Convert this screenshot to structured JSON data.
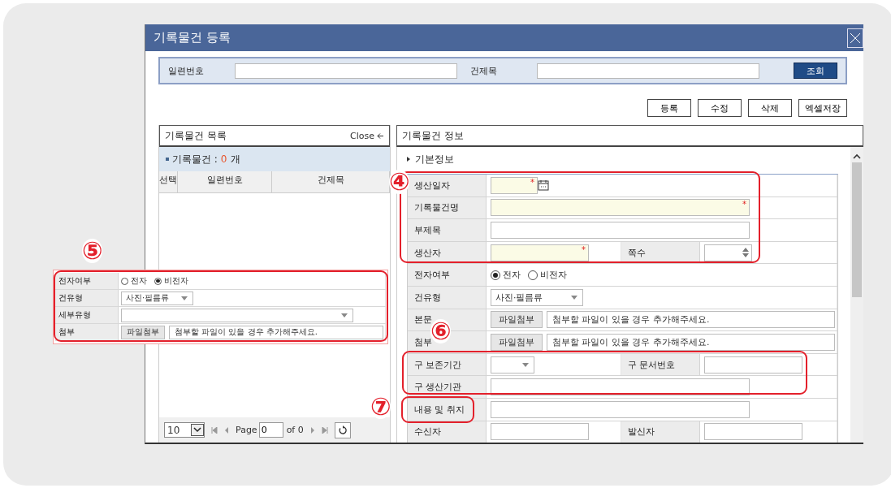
{
  "window": {
    "title": "기록물건 등록"
  },
  "search": {
    "fields": [
      {
        "label": "일련번호"
      },
      {
        "label": "건제목"
      }
    ],
    "button": "조회"
  },
  "actions": [
    "등록",
    "수정",
    "삭제",
    "엑셀저장"
  ],
  "list_panel": {
    "title": "기록물건 목록",
    "close": "Close",
    "count_label": "기록물건 :",
    "count": "0",
    "count_unit": "개",
    "columns": [
      "선택",
      "일련번호",
      "건제목"
    ],
    "pager": {
      "page_size": "10",
      "page_label": "Page",
      "page_value": "0",
      "of_label": "of 0"
    }
  },
  "detail_panel": {
    "title": "기록물건 정보",
    "section": "기본정보",
    "required_mark": "*",
    "rows": [
      {
        "fields": [
          {
            "label": "생산일자",
            "kind": "date",
            "required": true
          }
        ]
      },
      {
        "fields": [
          {
            "label": "기록물건명",
            "kind": "text",
            "required": true
          }
        ]
      },
      {
        "fields": [
          {
            "label": "부제목",
            "kind": "text",
            "required": false
          }
        ]
      },
      {
        "fields": [
          {
            "label": "생산자",
            "kind": "shorttext",
            "required": true
          },
          {
            "label": "쪽수",
            "kind": "number"
          }
        ]
      },
      {
        "fields": [
          {
            "label": "전자여부",
            "kind": "radio",
            "options": [
              {
                "label": "전자",
                "selected": true
              },
              {
                "label": "비전자",
                "selected": false
              }
            ]
          }
        ]
      },
      {
        "fields": [
          {
            "label": "건유형",
            "kind": "select",
            "value": "사진·필름류"
          }
        ]
      },
      {
        "fields": [
          {
            "label": "본문",
            "kind": "file",
            "button": "파일첨부",
            "placeholder": "첨부할 파일이 있을 경우 추가해주세요."
          }
        ]
      },
      {
        "fields": [
          {
            "label": "첨부",
            "kind": "file",
            "button": "파일첨부",
            "placeholder": "첨부할 파일이 있을 경우 추가해주세요."
          }
        ]
      },
      {
        "fields": [
          {
            "label": "구 보존기간",
            "kind": "shortselect"
          },
          {
            "label": "구 문서번호",
            "kind": "shorttext",
            "required": false
          }
        ]
      },
      {
        "fields": [
          {
            "label": "구 생산기관",
            "kind": "text",
            "required": false
          }
        ]
      },
      {
        "fields": [
          {
            "label": "내용 및 취지",
            "kind": "text",
            "required": false
          }
        ]
      },
      {
        "fields": [
          {
            "label": "수신자",
            "kind": "shorttext",
            "required": false
          },
          {
            "label": "발신자",
            "kind": "shorttext",
            "required": false
          }
        ]
      }
    ]
  },
  "inset": {
    "rows": [
      {
        "label": "전자여부",
        "kind": "radio",
        "options": [
          {
            "label": "전자",
            "selected": false
          },
          {
            "label": "비전자",
            "selected": true
          }
        ]
      },
      {
        "label": "건유형",
        "kind": "select",
        "value": "사진·필름류"
      },
      {
        "label": "세부유형",
        "kind": "wideselect"
      },
      {
        "label": "첨부",
        "kind": "file",
        "button": "파일첨부",
        "placeholder": "첨부할 파일이 있을 경우 추가해주세요."
      }
    ]
  },
  "callouts": [
    {
      "label": "④"
    },
    {
      "label": "⑤"
    },
    {
      "label": "⑥"
    },
    {
      "label": "⑦"
    }
  ]
}
